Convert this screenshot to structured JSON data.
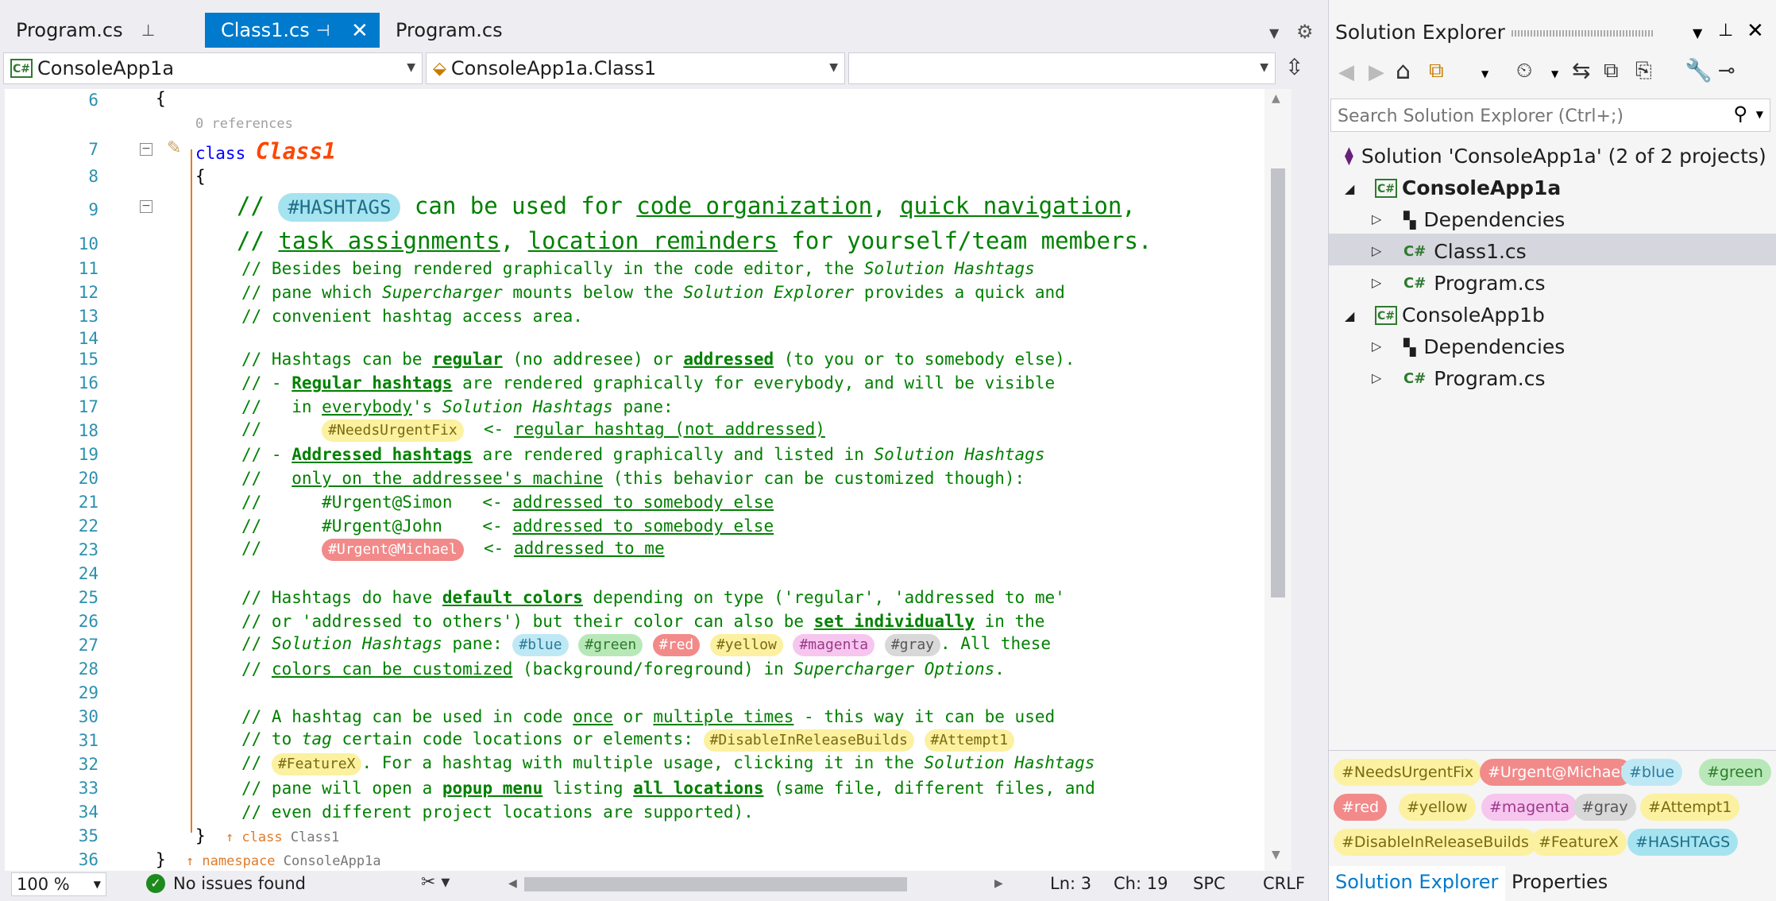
{
  "tabs": {
    "pinned": "Program.cs",
    "active": "Class1.cs",
    "preview": "Program.cs"
  },
  "nav": {
    "project": "ConsoleApp1a",
    "type": "ConsoleApp1a.Class1",
    "member": ""
  },
  "editor": {
    "line_numbers": [
      "6",
      "7",
      "8",
      "9",
      "10",
      "11",
      "12",
      "13",
      "14",
      "15",
      "16",
      "17",
      "18",
      "19",
      "20",
      "21",
      "22",
      "23",
      "24",
      "25",
      "26",
      "27",
      "28",
      "29",
      "30",
      "31",
      "32",
      "33",
      "34",
      "35",
      "36"
    ],
    "open_brace": "{",
    "references": "0 references",
    "class_kw": "class",
    "class_name": "Class1",
    "l9a": "// ",
    "hashtags_tag": "#HASHTAGS",
    "l9b": " can be used for ",
    "l9c": "code organization",
    "l9d": ", ",
    "l9e": "quick navigation",
    "l9f": ",",
    "l10a": "// ",
    "l10b": "task assignments",
    "l10c": ", ",
    "l10d": "location reminders",
    "l10e": " for yourself/team members.",
    "l11a": "// Besides being rendered graphically in the code editor, the ",
    "l11b": "Solution Hashtags",
    "l12a": "// pane which ",
    "l12b": "Supercharger",
    "l12c": " mounts below the ",
    "l12d": "Solution Explorer",
    "l12e": " provides a quick and",
    "l13": "// convenient hashtag access area.",
    "l15a": "// Hashtags can be ",
    "l15b": "regular",
    "l15c": " (no addresee) or ",
    "l15d": "addressed",
    "l15e": " (to you or to somebody else).",
    "l16a": "// - ",
    "l16b": "Regular hashtags",
    "l16c": " are rendered graphically for everybody, and will be visible",
    "l17a": "//   in ",
    "l17b": "everybody",
    "l17c": "'s ",
    "l17d": "Solution Hashtags",
    "l17e": " pane:",
    "l18a": "//      ",
    "l18tag": "#NeedsUrgentFix",
    "l18b": "  <- ",
    "l18c": "regular hashtag (not addressed)",
    "l19a": "// - ",
    "l19b": "Addressed hashtags",
    "l19c": " are rendered graphically and listed in ",
    "l19d": "Solution Hashtags",
    "l20a": "//   ",
    "l20b": "only on the addressee's machine",
    "l20c": " (this behavior can be customized though):",
    "l21a": "//      #Urgent@Simon   <- ",
    "l21b": "addressed to somebody else",
    "l22a": "//      #Urgent@John    <- ",
    "l22b": "addressed to somebody else",
    "l23a": "//      ",
    "l23tag": "#Urgent@Michael",
    "l23b": "  <- ",
    "l23c": "addressed to me",
    "l25a": "// Hashtags do have ",
    "l25b": "default colors",
    "l25c": " depending on type ('regular', 'addressed to me'",
    "l26a": "// or 'addressed to others') but their color can also be ",
    "l26b": "set individually",
    "l26c": " in the",
    "l27a": "// ",
    "l27b": "Solution Hashtags",
    "l27c": " pane: ",
    "c_blue": "#blue",
    "c_green": "#green",
    "c_red": "#red",
    "c_yellow": "#yellow",
    "c_magenta": "#magenta",
    "c_gray": "#gray",
    "l27d": ". All these",
    "l28a": "// ",
    "l28b": "colors can be customized",
    "l28c": " (background/foreground) in ",
    "l28d": "Supercharger Options",
    "l28e": ".",
    "l30a": "// A hashtag can be used in code ",
    "l30b": "once",
    "l30c": " or ",
    "l30d": "multiple times",
    "l30e": " - this way it can be used",
    "l31a": "// to ",
    "l31b": "tag",
    "l31c": " certain code locations or elements: ",
    "l31tag1": "#DisableInReleaseBuilds",
    "l31tag2": "#Attempt1",
    "l32a": "// ",
    "l32tag": "#FeatureX",
    "l32b": ". For a hashtag with multiple usage, clicking it in the ",
    "l32c": "Solution Hashtags",
    "l33a": "// pane will open a ",
    "l33b": "popup menu",
    "l33c": " listing ",
    "l33d": "all locations",
    "l33e": " (same file, different files, and",
    "l34": "// even different project locations are supported).",
    "l35a": "}",
    "l35b": "↑ class",
    "l35c": " Class1",
    "l36a": "}",
    "l36b": "↑ namespace",
    "l36c": " ConsoleApp1a"
  },
  "status": {
    "zoom": "100 %",
    "issues": "No issues found",
    "ln": "Ln: 3",
    "ch": "Ch: 19",
    "spc": "SPC",
    "crlf": "CRLF"
  },
  "solution_explorer": {
    "title": "Solution Explorer",
    "search_placeholder": "Search Solution Explorer (Ctrl+;)",
    "solution": "Solution 'ConsoleApp1a' (2 of 2 projects)",
    "project_a": "ConsoleApp1a",
    "deps_a": "Dependencies",
    "class1": "Class1.cs",
    "program_a": "Program.cs",
    "project_b": "ConsoleApp1b",
    "deps_b": "Dependencies",
    "program_b": "Program.cs"
  },
  "hashtag_pane": [
    "#NeedsUrgentFix",
    "#Urgent@Michael",
    "#blue",
    "#green",
    "#red",
    "#yellow",
    "#magenta",
    "#gray",
    "#Attempt1",
    "#DisableInReleaseBuilds",
    "#FeatureX",
    "#HASHTAGS"
  ],
  "bottom_tabs": {
    "solution_explorer": "Solution Explorer",
    "properties": "Properties"
  },
  "colors": {
    "accent": "#007acc",
    "comment": "#008000",
    "line_number": "#2b91af",
    "keyword": "#0000ff",
    "class_name": "#ff4500"
  }
}
